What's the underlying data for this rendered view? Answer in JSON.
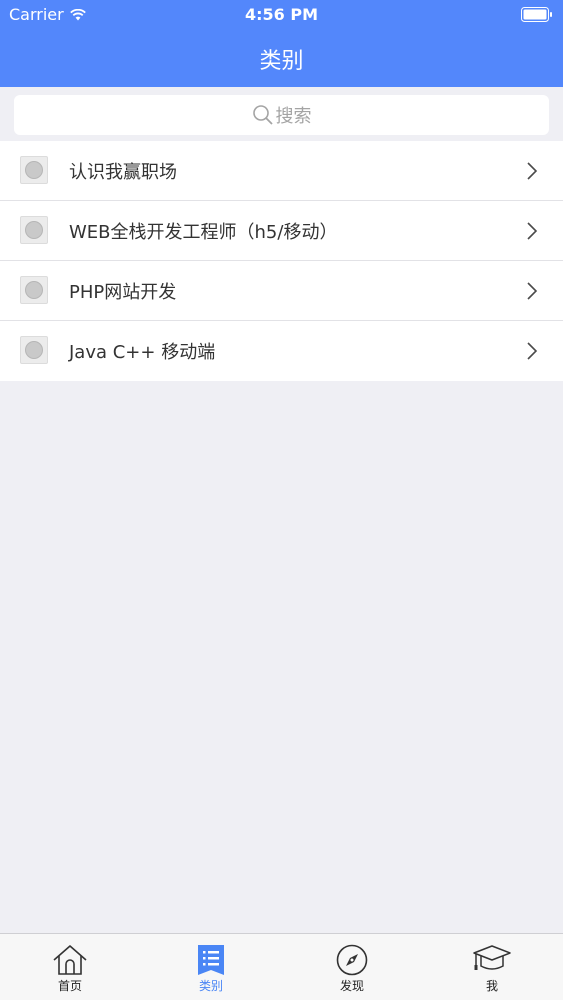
{
  "status_bar": {
    "carrier": "Carrier",
    "time": "4:56 PM"
  },
  "nav": {
    "title": "类别"
  },
  "search": {
    "placeholder": "搜索"
  },
  "categories": [
    {
      "label": "认识我赢职场"
    },
    {
      "label": "WEB全栈开发工程师（h5/移动）"
    },
    {
      "label": "PHP网站开发"
    },
    {
      "label": "Java C++ 移动端"
    }
  ],
  "tabs": [
    {
      "label": "首页",
      "icon": "home-icon"
    },
    {
      "label": "类别",
      "icon": "list-icon",
      "active": true
    },
    {
      "label": "发现",
      "icon": "compass-icon"
    },
    {
      "label": "我",
      "icon": "graduation-cap-icon"
    }
  ],
  "colors": {
    "accent": "#5387fb",
    "background": "#efeff4",
    "active_tab": "#4a86f5"
  }
}
